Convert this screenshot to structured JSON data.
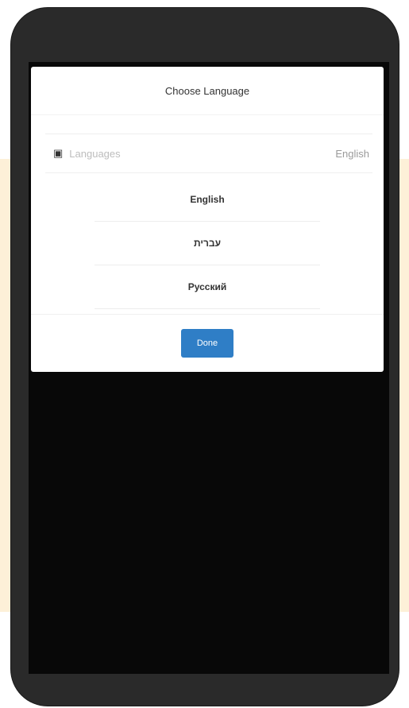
{
  "modal": {
    "title": "Choose Language",
    "language_row": {
      "icon": "language-icon",
      "label": "Languages",
      "value": "English"
    },
    "options": [
      "English",
      "עברית",
      "Русский"
    ],
    "done_label": "Done"
  },
  "colors": {
    "accent": "#2f7ec6",
    "background_accent": "#fdf0d8",
    "phone_frame": "#2a2a2a"
  }
}
